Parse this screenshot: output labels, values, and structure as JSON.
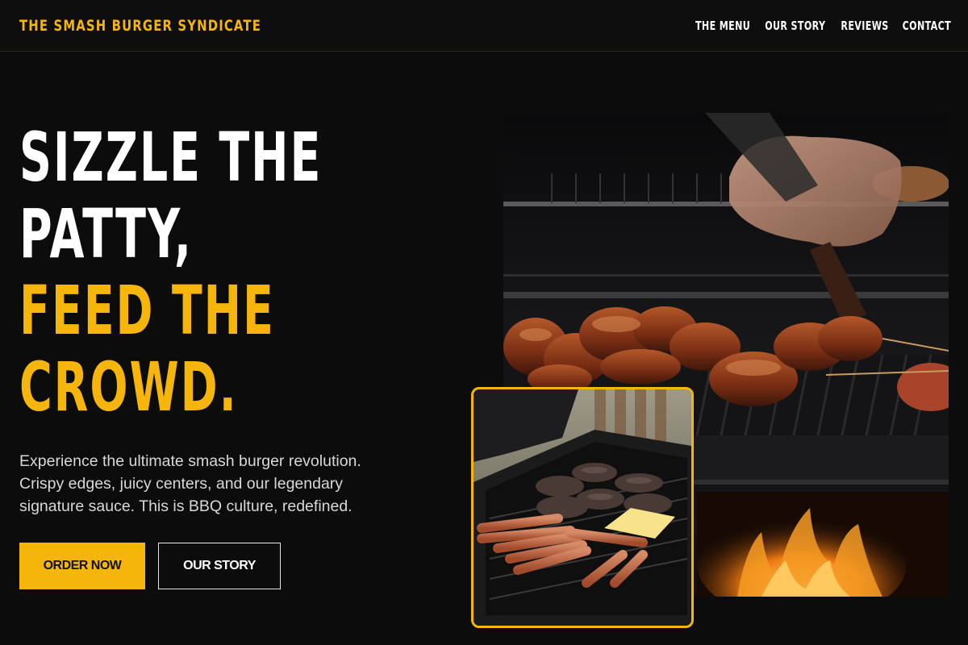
{
  "brand": {
    "name": "THE SMASH BURGER SYNDICATE"
  },
  "nav": {
    "items": [
      {
        "label": "THE MENU"
      },
      {
        "label": "OUR STORY"
      },
      {
        "label": "REVIEWS"
      },
      {
        "label": "CONTACT"
      }
    ]
  },
  "hero": {
    "title_line1": "SIZZLE THE",
    "title_line2": "PATTY,",
    "title_line3": "FEED THE",
    "title_line4": "CROWD.",
    "description_lines": [
      "Experience the ultimate smash burger revolution.",
      "Crispy edges, juicy centers, and our legendary",
      "signature sauce. This is BBQ culture, redefined."
    ],
    "primary_button": "ORDER NOW",
    "secondary_button": "OUR STORY"
  },
  "images": {
    "main_icon": "ribs-grill-photo",
    "inset_icon": "patties-hotdogs-grill-photo"
  },
  "colors": {
    "accent": "#f5b50a",
    "background": "#0c0c0c",
    "text": "#ffffff",
    "muted_text": "#d8d8d8"
  }
}
